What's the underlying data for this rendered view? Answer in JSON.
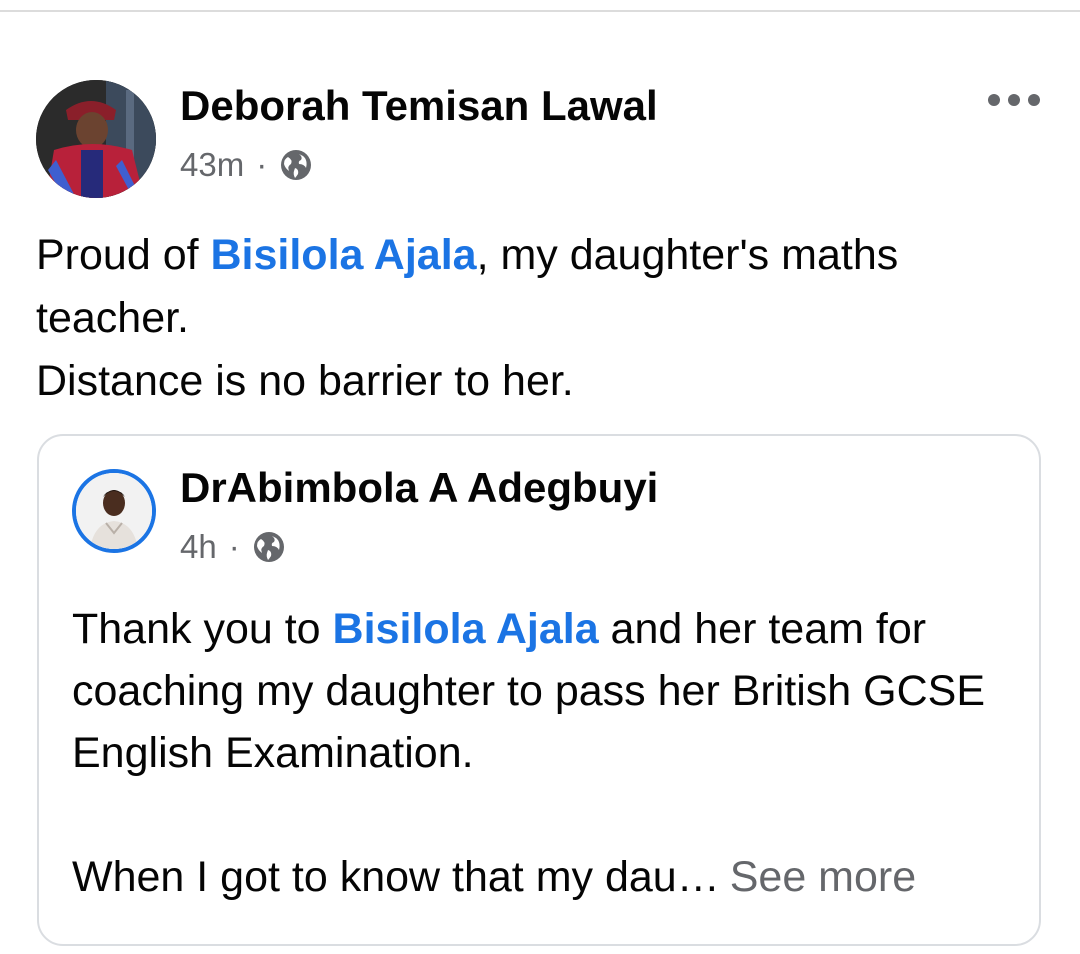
{
  "post": {
    "author": "Deborah Temisan Lawal",
    "time": "43m",
    "separator": "·",
    "privacy_icon": "globe-icon",
    "more_icon": "more-horizontal-icon",
    "text": {
      "part1": "Proud of ",
      "mention": "Bisilola Ajala",
      "part2": ", my daughter's maths teacher.",
      "line2": "Distance is no barrier to her."
    }
  },
  "shared": {
    "author": "DrAbimbola A Adegbuyi",
    "time": "4h",
    "separator": "·",
    "privacy_icon": "globe-icon",
    "text": {
      "part1": "Thank you to ",
      "mention": "Bisilola Ajala",
      "part2": " and her team for coaching my daughter to pass her British GCSE English Examination.",
      "truncated": "When I got to know that my dau…",
      "see_more": "See more"
    }
  },
  "colors": {
    "link": "#1b74e4",
    "secondary_text": "#65676b",
    "primary_text": "#050505",
    "card_border": "#dadde1"
  }
}
